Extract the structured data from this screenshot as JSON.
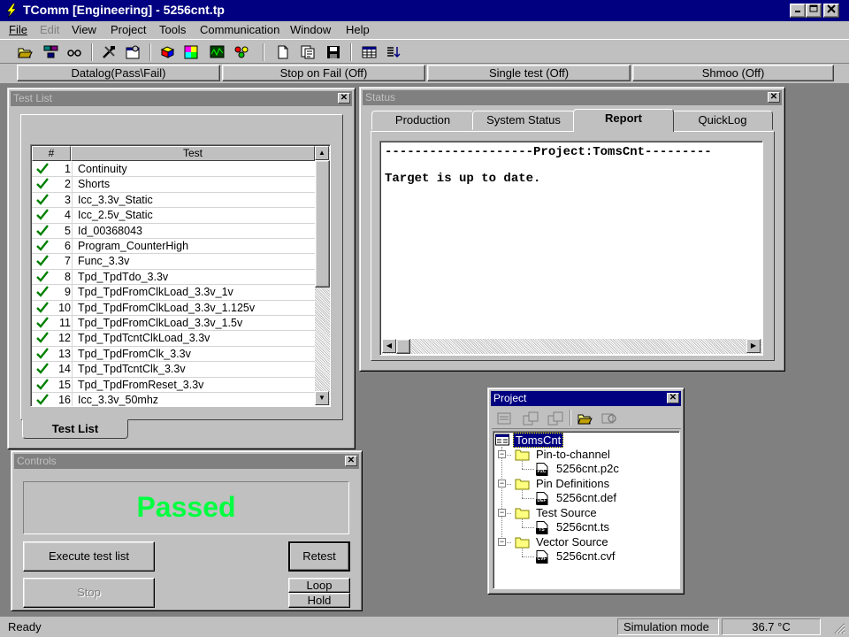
{
  "window": {
    "title": "TComm [Engineering] - 5256cnt.tp"
  },
  "menu": [
    "File",
    "Edit",
    "View",
    "Project",
    "Tools",
    "Communication",
    "Window",
    "Help"
  ],
  "mode_bar": [
    "Datalog(Pass\\Fail)",
    "Stop on Fail  (Off)",
    "Single test  (Off)",
    "Shmoo  (Off)"
  ],
  "test_list": {
    "title": "Test List",
    "columns": [
      "#",
      "Test"
    ],
    "rows": [
      {
        "num": "1",
        "name": "Continuity"
      },
      {
        "num": "2",
        "name": "Shorts"
      },
      {
        "num": "3",
        "name": "Icc_3.3v_Static"
      },
      {
        "num": "4",
        "name": "Icc_2.5v_Static"
      },
      {
        "num": "5",
        "name": "Id_00368043"
      },
      {
        "num": "6",
        "name": "Program_CounterHigh"
      },
      {
        "num": "7",
        "name": "Func_3.3v"
      },
      {
        "num": "8",
        "name": "Tpd_TpdTdo_3.3v"
      },
      {
        "num": "9",
        "name": "Tpd_TpdFromClkLoad_3.3v_1v"
      },
      {
        "num": "10",
        "name": "Tpd_TpdFromClkLoad_3.3v_1.125v"
      },
      {
        "num": "11",
        "name": "Tpd_TpdFromClkLoad_3.3v_1.5v"
      },
      {
        "num": "12",
        "name": "Tpd_TpdTcntClkLoad_3.3v"
      },
      {
        "num": "13",
        "name": "Tpd_TpdFromClk_3.3v"
      },
      {
        "num": "14",
        "name": "Tpd_TpdTcntClk_3.3v"
      },
      {
        "num": "15",
        "name": "Tpd_TpdFromReset_3.3v"
      },
      {
        "num": "16",
        "name": "Icc_3.3v_50mhz"
      }
    ],
    "tab_label": "Test List"
  },
  "controls": {
    "title": "Controls",
    "result": "Passed",
    "result_color": "#00ff40",
    "execute_label": "Execute test list",
    "retest_label": "Retest",
    "stop_label": "Stop",
    "loop_label": "Loop",
    "hold_label": "Hold"
  },
  "status": {
    "title": "Status",
    "tabs": [
      "Production",
      "System Status",
      "Report",
      "QuickLog"
    ],
    "active_tab": "Report",
    "report_line1": "--------------------Project:TomsCnt---------",
    "report_line2": "Target is up to date."
  },
  "project": {
    "title": "Project",
    "root": "TomsCnt",
    "folders": [
      {
        "name": "Pin-to-channel",
        "file": "5256cnt.p2c",
        "icon": "P2C"
      },
      {
        "name": "Pin Definitions",
        "file": "5256cnt.def",
        "icon": "DEF"
      },
      {
        "name": "Test Source",
        "file": "5256cnt.ts",
        "icon": "TS"
      },
      {
        "name": "Vector Source",
        "file": "5256cnt.cvf",
        "icon": "CVF"
      }
    ]
  },
  "statusbar": {
    "left": "Ready",
    "mode": "Simulation mode",
    "temp": "36.7 °C"
  },
  "icons": [
    "app-lightning-icon",
    "open-folder-icon",
    "network-icon",
    "glasses-icon",
    "tools-icon",
    "settings-window-icon",
    "cube-icon",
    "palette-icon",
    "scope-icon",
    "traffic-light-icon",
    "new-file-icon",
    "properties-icon",
    "save-icon",
    "grid-icon",
    "sort-icon"
  ]
}
